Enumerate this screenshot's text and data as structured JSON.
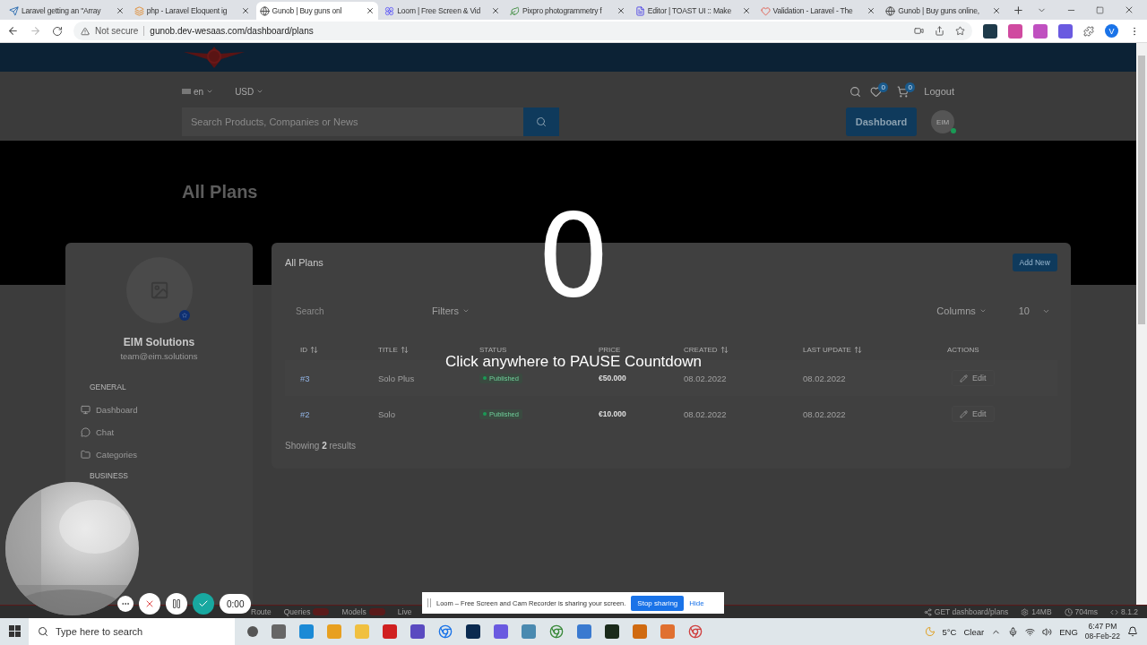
{
  "browser": {
    "tabs": [
      {
        "title": "Laravel getting an \"Array",
        "kind": "plane",
        "selected": false
      },
      {
        "title": "php - Laravel Eloquent ig",
        "kind": "stack",
        "selected": false
      },
      {
        "title": "Gunob | Buy guns onl",
        "kind": "globe",
        "selected": true
      },
      {
        "title": "Loom | Free Screen & Vid",
        "kind": "flower",
        "selected": false
      },
      {
        "title": "Pixpro photogrammetry f",
        "kind": "leaf",
        "selected": false
      },
      {
        "title": "Editor | TOAST UI :: Make",
        "kind": "editor",
        "selected": false
      },
      {
        "title": "Validation - Laravel - The",
        "kind": "heart",
        "selected": false
      },
      {
        "title": "Gunob | Buy guns online,",
        "kind": "globe",
        "selected": false
      }
    ],
    "security": "Not secure",
    "url": "gunob.dev-wesaas.com/dashboard/plans",
    "profile_initial": "V"
  },
  "site_header": {
    "language": "en",
    "currency": "USD",
    "search_placeholder": "Search Products, Companies or News",
    "wishlist_count": "0",
    "cart_count": "0",
    "logout": "Logout",
    "dashboard_button": "Dashboard",
    "avatar": "EIM"
  },
  "page_title": "All Plans",
  "profile": {
    "name": "EIM Solutions",
    "email": "team@eim.solutions",
    "sections": [
      {
        "heading": "GENERAL",
        "items": [
          {
            "label": "Dashboard",
            "kind": "monitor"
          },
          {
            "label": "Chat",
            "kind": "chat"
          },
          {
            "label": "Categories",
            "kind": "folder"
          }
        ]
      },
      {
        "heading": "BUSINESS"
      }
    ]
  },
  "plans": {
    "title": "All Plans",
    "add_button": "Add New",
    "search_placeholder": "Search",
    "filters": "Filters",
    "columns_button": "Columns",
    "page_size": "10",
    "columns": [
      {
        "label": "ID",
        "sortable": true
      },
      {
        "label": "TITLE",
        "sortable": true
      },
      {
        "label": "STATUS",
        "sortable": false
      },
      {
        "label": "PRICE",
        "sortable": false
      },
      {
        "label": "CREATED",
        "sortable": true
      },
      {
        "label": "LAST UPDATE",
        "sortable": true
      },
      {
        "label": "ACTIONS",
        "sortable": false
      }
    ],
    "rows": [
      {
        "id": "#3",
        "title": "Solo Plus",
        "status": "Published",
        "price": "€50.000",
        "created": "08.02.2022",
        "updated": "08.02.2022",
        "action": "Edit"
      },
      {
        "id": "#2",
        "title": "Solo",
        "status": "Published",
        "price": "€10.000",
        "created": "08.02.2022",
        "updated": "08.02.2022",
        "action": "Edit"
      }
    ],
    "summary": "Showing **2** results"
  },
  "countdown": {
    "number": "0",
    "message": "Click anywhere to PAUSE Countdown"
  },
  "recorder": {
    "timer": "0:00"
  },
  "share_bar": {
    "message": "Loom – Free Screen and Cam Recorder is sharing your screen.",
    "stop_button": "Stop sharing",
    "hide_link": "Hide"
  },
  "debug_bar": {
    "left": [
      {
        "label": "Route",
        "badge": false
      },
      {
        "label": "Queries",
        "badge": true
      },
      {
        "label": "Models",
        "badge": true
      },
      {
        "label": "Live",
        "badge": false
      }
    ],
    "right": [
      {
        "label": "GET dashboard/plans",
        "kind": "share"
      },
      {
        "label": "14MB",
        "kind": "gear"
      },
      {
        "label": "704ms",
        "kind": "clock"
      },
      {
        "label": "8.1.2",
        "kind": "code"
      }
    ]
  },
  "taskbar": {
    "search_placeholder": "Type here to search",
    "temperature": "5°C",
    "weather": "Clear",
    "language": "ENG",
    "time": "6:47 PM",
    "date": "08-Feb-22"
  }
}
